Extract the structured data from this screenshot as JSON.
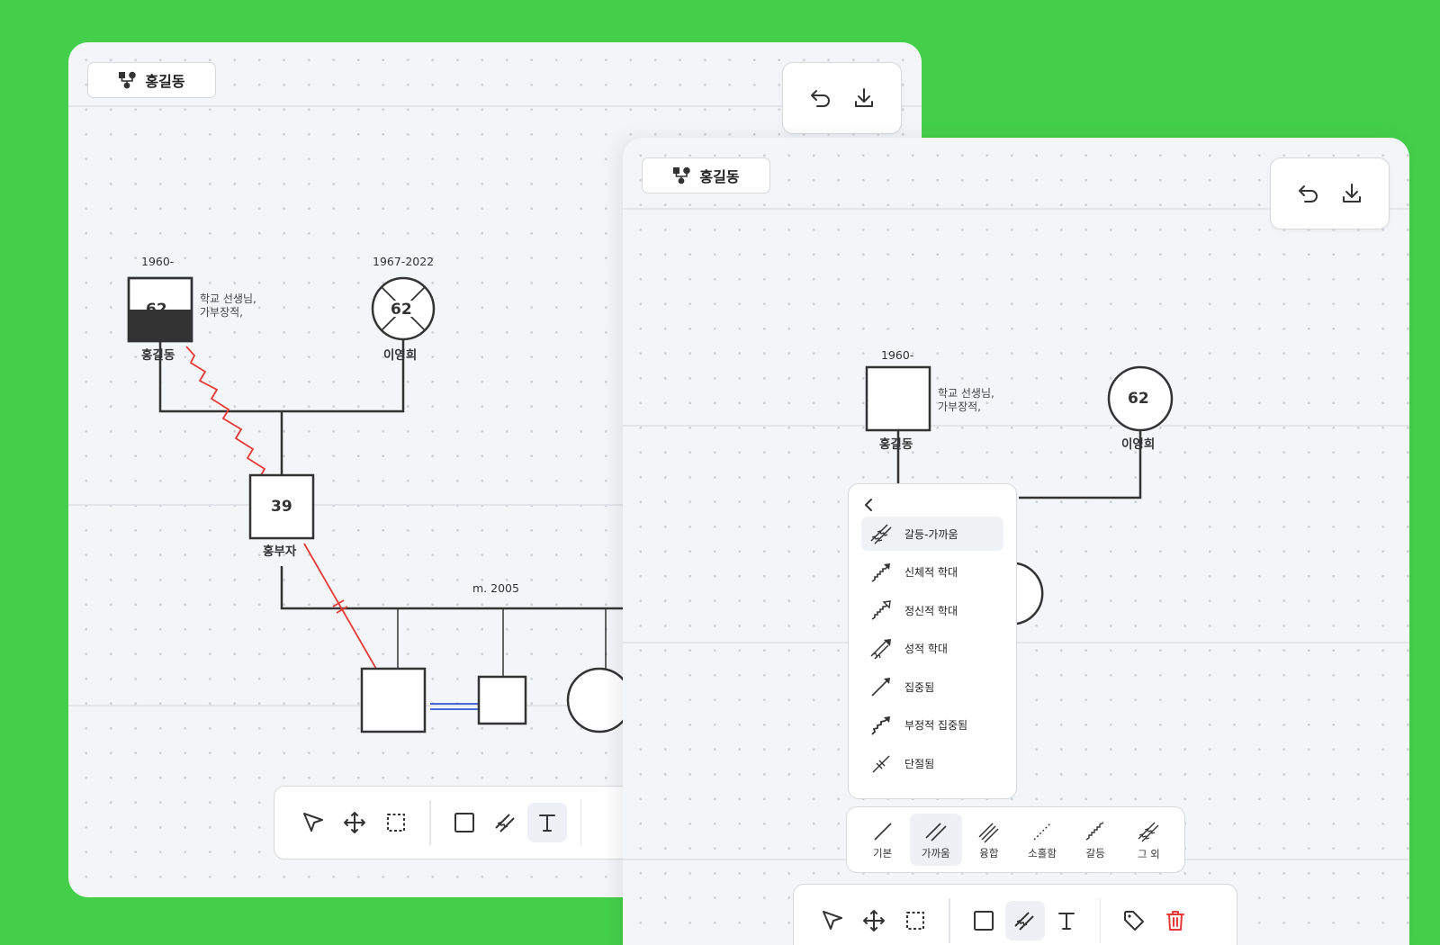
{
  "colors": {
    "background": "#44cf4a",
    "canvas": "#f4f5f9",
    "conflict_line": "#e53935",
    "partner_line": "#2f56d8",
    "delete": "#e53935"
  },
  "back_window": {
    "title": "홍길동",
    "toolbar": {
      "undo_icon": "undo-icon",
      "download_icon": "download-icon"
    },
    "people": {
      "father": {
        "birth": "1960-",
        "age": "62",
        "name": "홍길동",
        "note_line1": "학교 선생님,",
        "note_line2": "가부장적,"
      },
      "mother": {
        "dates": "1967-2022",
        "age": "62",
        "name": "이영희"
      },
      "son": {
        "age": "39",
        "name": "홍부자"
      }
    },
    "marriage_label": "m. 2005"
  },
  "front_window": {
    "title": "홍길동",
    "toolbar": {
      "undo_icon": "undo-icon",
      "download_icon": "download-icon"
    },
    "people": {
      "father": {
        "birth": "1960-",
        "name": "홍길동",
        "note_line1": "학교 선생님,",
        "note_line2": "가부장적,"
      },
      "mother": {
        "age": "62",
        "name": "이영희"
      }
    },
    "submenu": {
      "items": [
        {
          "label": "갈등-가까움",
          "icon": "conflict-close-icon"
        },
        {
          "label": "신체적 학대",
          "icon": "physical-abuse-icon"
        },
        {
          "label": "정신적 학대",
          "icon": "emotional-abuse-icon"
        },
        {
          "label": "성적 학대",
          "icon": "sexual-abuse-icon"
        },
        {
          "label": "집중됨",
          "icon": "focused-icon"
        },
        {
          "label": "부정적 집중됨",
          "icon": "negative-focused-icon"
        },
        {
          "label": "단절됨",
          "icon": "cutoff-icon"
        }
      ]
    },
    "line_types": [
      {
        "label": "기본",
        "icon": "basic-line-icon"
      },
      {
        "label": "가까움",
        "icon": "close-line-icon"
      },
      {
        "label": "융합",
        "icon": "fused-line-icon"
      },
      {
        "label": "소홀함",
        "icon": "distant-line-icon"
      },
      {
        "label": "갈등",
        "icon": "conflict-line-icon"
      },
      {
        "label": "그 외",
        "icon": "other-line-icon"
      }
    ]
  }
}
